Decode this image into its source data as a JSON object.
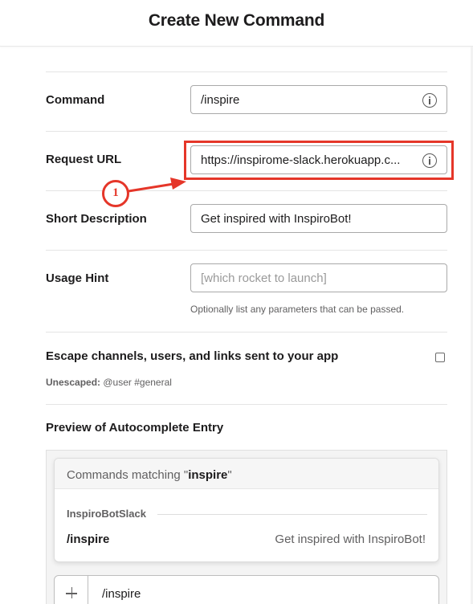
{
  "header": {
    "title": "Create New Command"
  },
  "form": {
    "command": {
      "label": "Command",
      "value": "/inspire"
    },
    "request_url": {
      "label": "Request URL",
      "value": "https://inspirome-slack.herokuapp.c..."
    },
    "short_description": {
      "label": "Short Description",
      "value": "Get inspired with InspiroBot!"
    },
    "usage_hint": {
      "label": "Usage Hint",
      "placeholder": "[which rocket to launch]",
      "help": "Optionally list any parameters that can be passed."
    },
    "escape": {
      "label": "Escape channels, users, and links sent to your app",
      "checked": false,
      "unescaped_label": "Unescaped:",
      "unescaped_example": "@user #general"
    }
  },
  "annotation": {
    "number": "1",
    "color": "#e53629"
  },
  "preview": {
    "title": "Preview of Autocomplete Entry",
    "matching_prefix": "Commands matching \"",
    "matching_term": "inspire",
    "matching_suffix": "\"",
    "app_name": "InspiroBotSlack",
    "command": "/inspire",
    "description": "Get inspired with InspiroBot!",
    "message_text": "/inspire"
  }
}
